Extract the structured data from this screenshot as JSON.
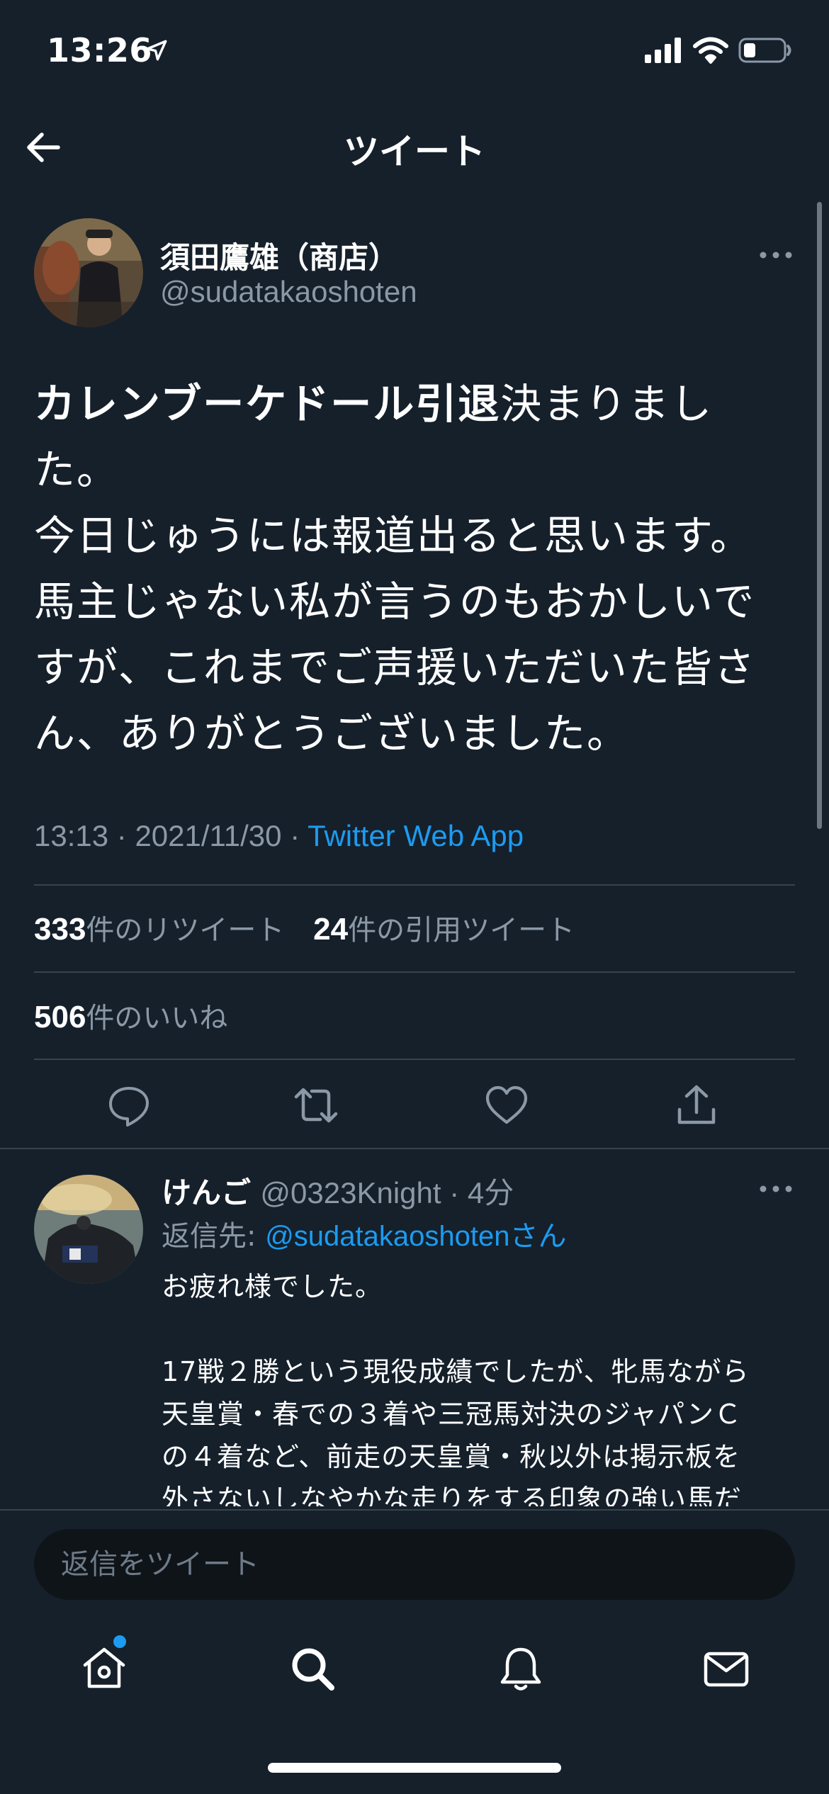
{
  "status_bar": {
    "time": "13:26"
  },
  "nav": {
    "title": "ツイート"
  },
  "tweet": {
    "author_name": "須田鷹雄（商店）",
    "author_handle": "@sudatakaoshoten",
    "text_highlight": "カレンブーケドール引退",
    "text_line1_rest": "決まりまし",
    "text_line2": "た。",
    "text_line3": "今日じゅうには報道出ると思います。",
    "text_line4": "馬主じゃない私が言うのもおかしいで",
    "text_line5": "すが、これまでご声援いただいた皆さ",
    "text_line6": "ん、ありがとうございました。",
    "time": "13:13",
    "date": "2021/11/30",
    "source": "Twitter Web App",
    "retweets": {
      "count": "333",
      "label": "件のリツイート"
    },
    "quotes": {
      "count": "24",
      "label": "件の引用ツイート"
    },
    "likes": {
      "count": "506",
      "label": "件のいいね"
    }
  },
  "reply": {
    "name": "けんご",
    "handle": "@0323Knight",
    "age": "4分",
    "reply_to_label": "返信先: ",
    "reply_to_handle": "@sudatakaoshoten",
    "reply_to_suffix": "さん",
    "line1": "お疲れ様でした。",
    "line2": "17戦２勝という現役成績でしたが、牝馬ながら",
    "line3": "天皇賞・春での３着や三冠馬対決のジャパンＣ",
    "line4": "の４着など、前走の天皇賞・秋以外は掲示板を",
    "line5": "外さないしなやかな走りをする印象の強い馬だ"
  },
  "compose": {
    "placeholder": "返信をツイート"
  },
  "colors": {
    "background": "#15202b",
    "accent": "#1d9bf0",
    "secondary_text": "#8b98a5",
    "divider": "#38444d"
  },
  "icons": {
    "status": [
      "location-arrow-icon",
      "signal-icon",
      "wifi-icon",
      "battery-icon"
    ],
    "actions": [
      "reply-icon",
      "retweet-icon",
      "like-icon",
      "share-icon"
    ],
    "tabs": [
      "home-icon",
      "search-icon",
      "notifications-icon",
      "messages-icon"
    ]
  }
}
